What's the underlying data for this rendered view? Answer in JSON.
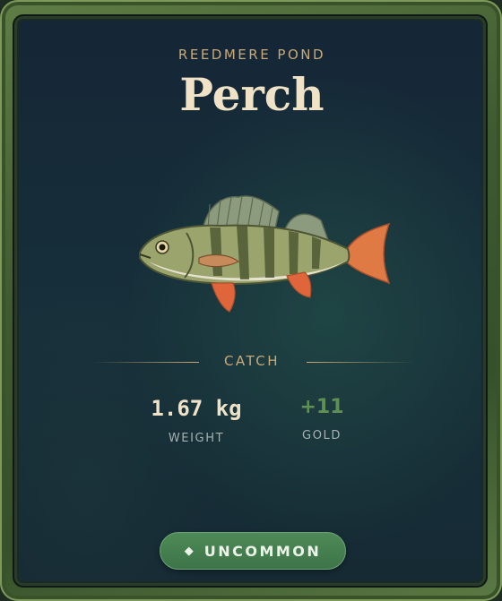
{
  "card": {
    "location": "REEDMERE POND",
    "fish_name": "Perch",
    "fish_image_icon": "perch-fish-illustration"
  },
  "catch": {
    "label": "CATCH",
    "weight_value": "1.67 kg",
    "weight_label": "WEIGHT",
    "gold_value": "+11",
    "gold_label": "GOLD"
  },
  "rarity": {
    "icon": "diamond-icon",
    "icon_glyph": "◆",
    "label": "UNCOMMON",
    "color": "#4e8a57"
  },
  "colors": {
    "frame": "#5f7d45",
    "card_background": "#152636",
    "accent_gold": "#c9a978",
    "title": "#efe2c6",
    "gold_value": "#5f8f52"
  }
}
